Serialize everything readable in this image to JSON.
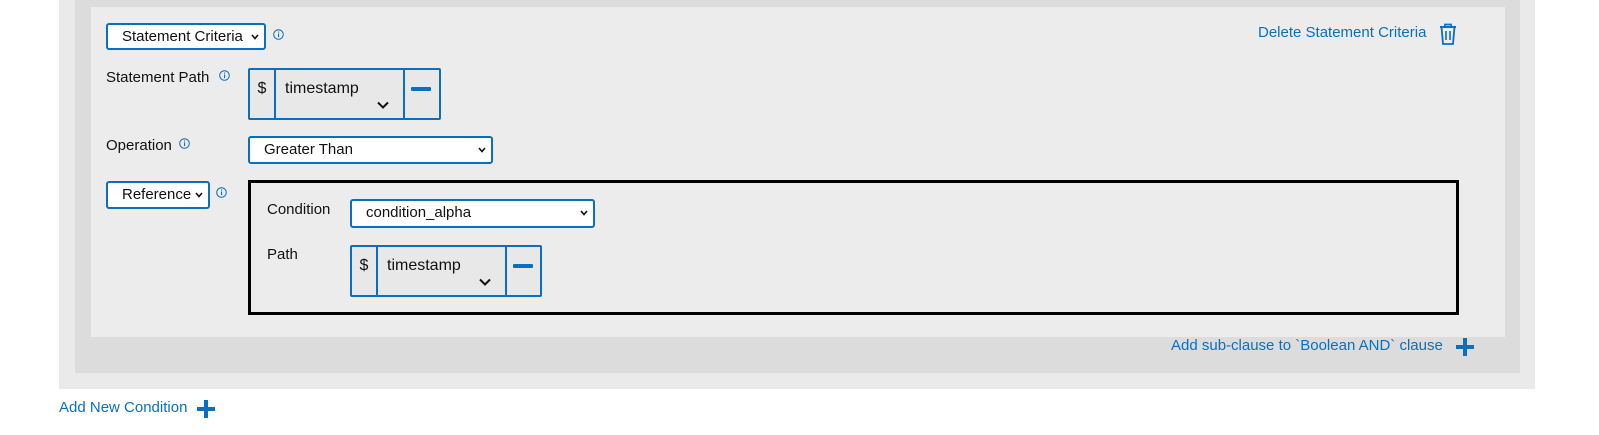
{
  "criteria": {
    "type_select": "Statement Criteria",
    "delete_label": "Delete Statement Criteria",
    "statement_path_label": "Statement Path",
    "statement_path": {
      "prefix": "$",
      "value": "timestamp"
    },
    "operation_label": "Operation",
    "operation_select": "Greater Than",
    "value_type_select": "Reference",
    "reference": {
      "condition_label": "Condition",
      "condition_select": "condition_alpha",
      "path_label": "Path",
      "path": {
        "prefix": "$",
        "value": "timestamp"
      }
    }
  },
  "add_sub_clause_label": "Add sub-clause to `Boolean AND` clause",
  "add_new_condition_label": "Add New Condition",
  "icons": {
    "info": "info-icon",
    "trash": "trash-icon",
    "plus": "plus-icon",
    "minus": "minus-icon",
    "chevron": "chevron-down-icon"
  },
  "colors": {
    "accent": "#0a6fc0",
    "panel": "#ececec",
    "panel_dark": "#dcdcdc"
  }
}
